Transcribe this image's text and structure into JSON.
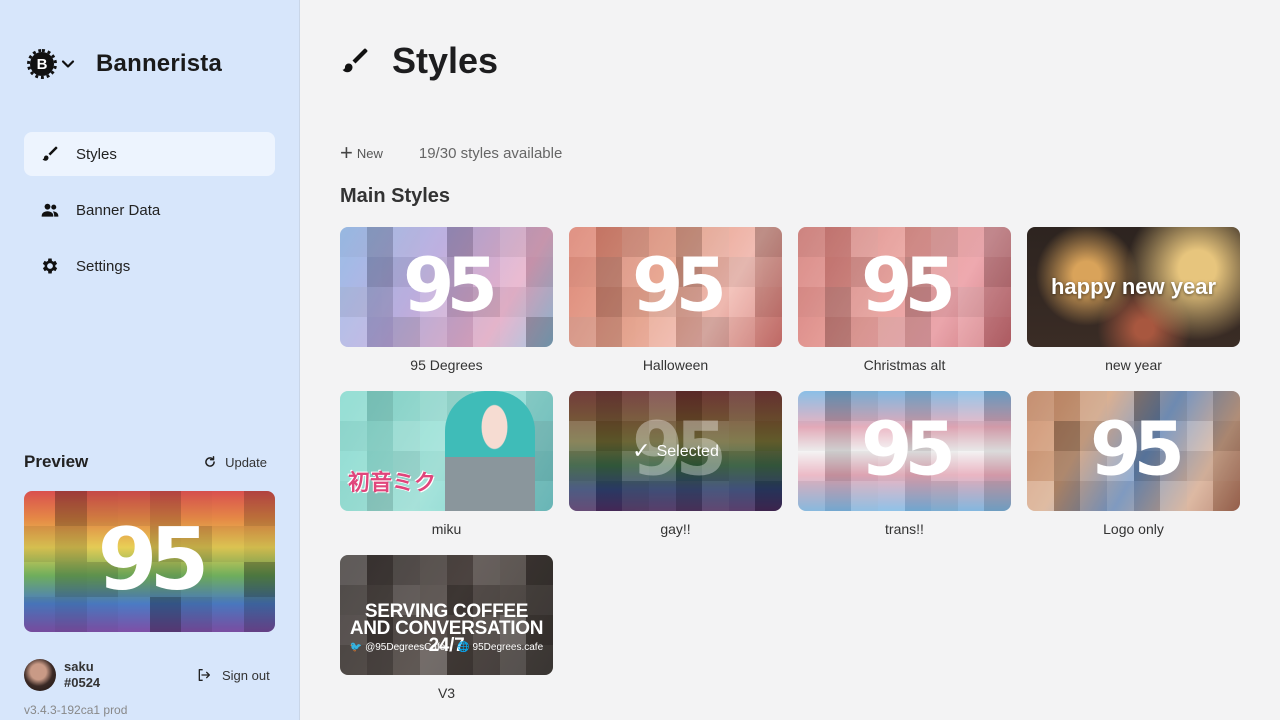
{
  "app": {
    "name": "Bannerista",
    "logo_letter": "B",
    "version": "v3.4.3-192ca1 prod"
  },
  "nav": [
    {
      "label": "Styles",
      "icon": "brush-icon",
      "active": true
    },
    {
      "label": "Banner Data",
      "icon": "people-icon",
      "active": false
    },
    {
      "label": "Settings",
      "icon": "gear-icon",
      "active": false
    }
  ],
  "preview": {
    "title": "Preview",
    "update_label": "Update",
    "logo_text": "95"
  },
  "user": {
    "name": "saku",
    "tag": "#0524",
    "signout_label": "Sign out"
  },
  "page": {
    "title": "Styles",
    "new_label": "New",
    "count_label": "19/30 styles available",
    "section_title": "Main Styles"
  },
  "styles": [
    {
      "name": "95 Degrees",
      "theme": "blue",
      "overlay": "95"
    },
    {
      "name": "Halloween",
      "theme": "red",
      "overlay": "95"
    },
    {
      "name": "Christmas alt",
      "theme": "red",
      "overlay": "95"
    },
    {
      "name": "new year",
      "theme": "fireworks",
      "overlay": "happy new year"
    },
    {
      "name": "miku",
      "theme": "teal",
      "overlay": "初音ミク"
    },
    {
      "name": "gay!!",
      "theme": "rainbow-dark",
      "overlay": "Selected",
      "selected": true
    },
    {
      "name": "trans!!",
      "theme": "trans",
      "overlay": "95"
    },
    {
      "name": "Logo only",
      "theme": "plain",
      "overlay": "95"
    },
    {
      "name": "V3",
      "theme": "dark",
      "overlay": "SERVING COFFEE AND CONVERSATION 24/7",
      "sub_left": "@95DegreesCafe",
      "sub_right": "95Degrees.cafe"
    }
  ],
  "colors": {
    "sidebar_bg": "#d7e6fb",
    "active_nav_bg": "#edf4fe",
    "main_bg": "#f3f3f4"
  }
}
